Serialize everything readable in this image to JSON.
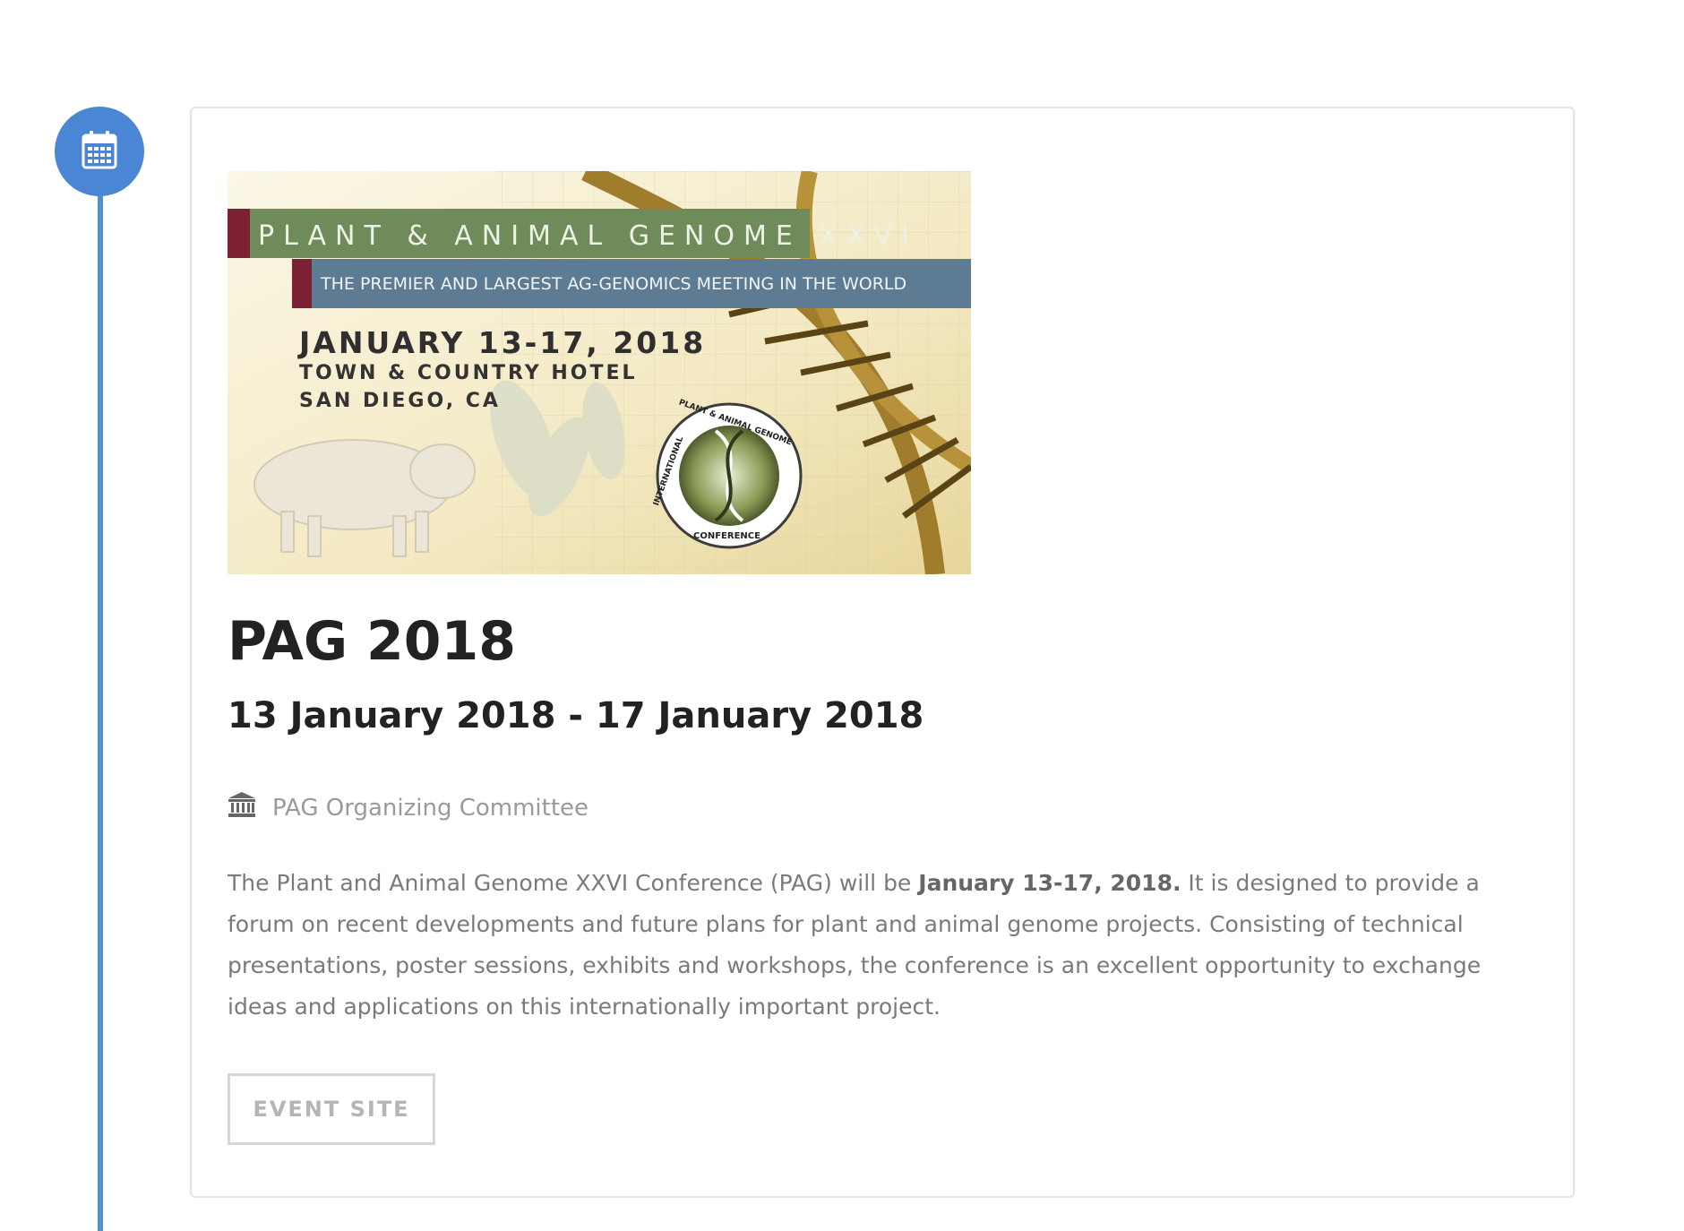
{
  "event": {
    "banner": {
      "line1": "PLANT & ANIMAL GENOME XXVI",
      "line2": "THE PREMIER AND LARGEST AG-GENOMICS MEETING IN THE WORLD",
      "date": "JANUARY 13-17, 2018",
      "venue": "TOWN & COUNTRY HOTEL",
      "city": "SAN DIEGO, CA",
      "seal_top": "PLANT & ANIMAL GENOME",
      "seal_left": "INTERNATIONAL",
      "seal_bottom": "CONFERENCE"
    },
    "title": "PAG 2018",
    "dates": "13 January 2018 - 17 January 2018",
    "organizer": "PAG Organizing Committee",
    "description_pre": "The Plant and Animal Genome XXVI Conference (PAG) will be ",
    "description_bold": "January 13-17, 2018.",
    "description_post": " It is designed to provide a forum on recent developments and future plans for plant and animal genome projects. Consisting of technical presentations, poster sessions, exhibits and workshops, the conference is an excellent opportunity to exchange ideas and applications on this internationally important project.",
    "button_label": "EVENT SITE"
  },
  "icons": {
    "timeline": "calendar-icon",
    "organizer": "institution-icon"
  },
  "colors": {
    "accent": "#4a86d4",
    "banner_green": "#6f8b5a",
    "banner_blue": "#5d7b93",
    "banner_maroon": "#7d2235"
  }
}
